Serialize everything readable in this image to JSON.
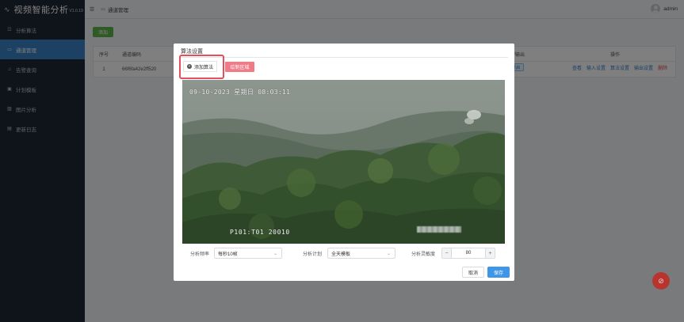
{
  "app": {
    "title": "视频智能分析",
    "version": "V1.0.19"
  },
  "sidebar": {
    "items": [
      {
        "label": "分析算法",
        "icon": "grid-icon",
        "glyph": "☷"
      },
      {
        "label": "通道管理",
        "icon": "channel-icon",
        "glyph": "▭",
        "active": true
      },
      {
        "label": "告警查询",
        "icon": "bell-icon",
        "glyph": "♫"
      },
      {
        "label": "计划模板",
        "icon": "calendar-icon",
        "glyph": "▣"
      },
      {
        "label": "图片分析",
        "icon": "image-icon",
        "glyph": "▨"
      },
      {
        "label": "更新日志",
        "icon": "log-icon",
        "glyph": "▤"
      }
    ]
  },
  "header": {
    "breadcrumb": "通道管理",
    "user": "admin"
  },
  "toolbar": {
    "add_label": "添加"
  },
  "table": {
    "headers": {
      "no": "序号",
      "code": "通道编码",
      "output": "告警输出",
      "ops": "操作"
    },
    "rows": [
      {
        "no": "1",
        "code": "66f6fa42e2ff520",
        "output_tag": "已开启",
        "ops": [
          "查看",
          "输入设置",
          "算法设置",
          "输出设置",
          "删除"
        ]
      }
    ]
  },
  "modal": {
    "title": "算法设置",
    "add_algorithm": "添加算法",
    "region_button": "绘制区域",
    "video": {
      "timestamp": "09-10-2023 星期日 08:03:11",
      "camera": "P101:T01   20010"
    },
    "form": {
      "freq_label": "分析频率",
      "freq_value": "每秒10帧",
      "plan_label": "分析计划",
      "plan_value": "全天模板",
      "sens_label": "分析灵敏度",
      "sens_value": "80",
      "minus": "−",
      "plus": "+",
      "chevron": "⌄"
    },
    "cancel_label": "取消",
    "save_label": "保存"
  },
  "fab": {
    "icon": "alert-icon",
    "glyph": "⊘"
  },
  "colors": {
    "sidebar_bg": "#1f2635",
    "active": "#3b82c6",
    "add": "#5fb34b",
    "save": "#3f95e8",
    "highlight": "#e64e5c"
  }
}
